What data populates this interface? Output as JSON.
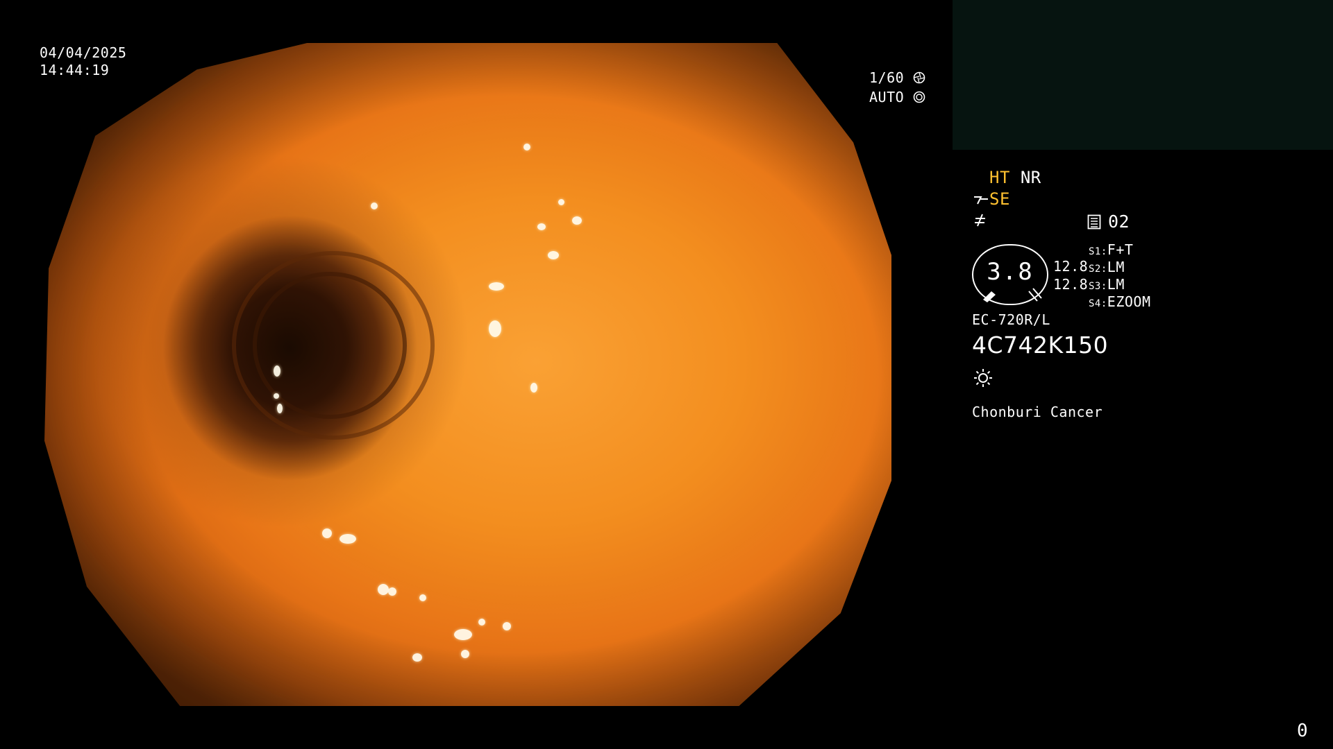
{
  "datetime": {
    "date": "04/04/2025",
    "time": "14:44:19"
  },
  "camera": {
    "shutter": "1/60",
    "iris": "AUTO",
    "shutter_icon": "aperture-icon",
    "iris_icon": "iris-icon"
  },
  "modes": {
    "ht": "HT",
    "nr": "NR",
    "se": "SE"
  },
  "memory": {
    "icon": "memory-card-icon",
    "value": "02"
  },
  "gauge": {
    "value": "3.8",
    "reading_top": "12.8",
    "reading_bottom": "12.8"
  },
  "switches": [
    {
      "key": "S1",
      "value": "F+T"
    },
    {
      "key": "S2",
      "value": "LM"
    },
    {
      "key": "S3",
      "value": "LM"
    },
    {
      "key": "S4",
      "value": "EZOOM"
    }
  ],
  "scope": {
    "model": "EC-720R/L",
    "serial": "4C742K150"
  },
  "light_icon": "sun-icon",
  "institution": "Chonburi Cancer",
  "counter": "0",
  "colors": {
    "accent_yellow": "#ffc130",
    "panel_dark": "#061410"
  }
}
